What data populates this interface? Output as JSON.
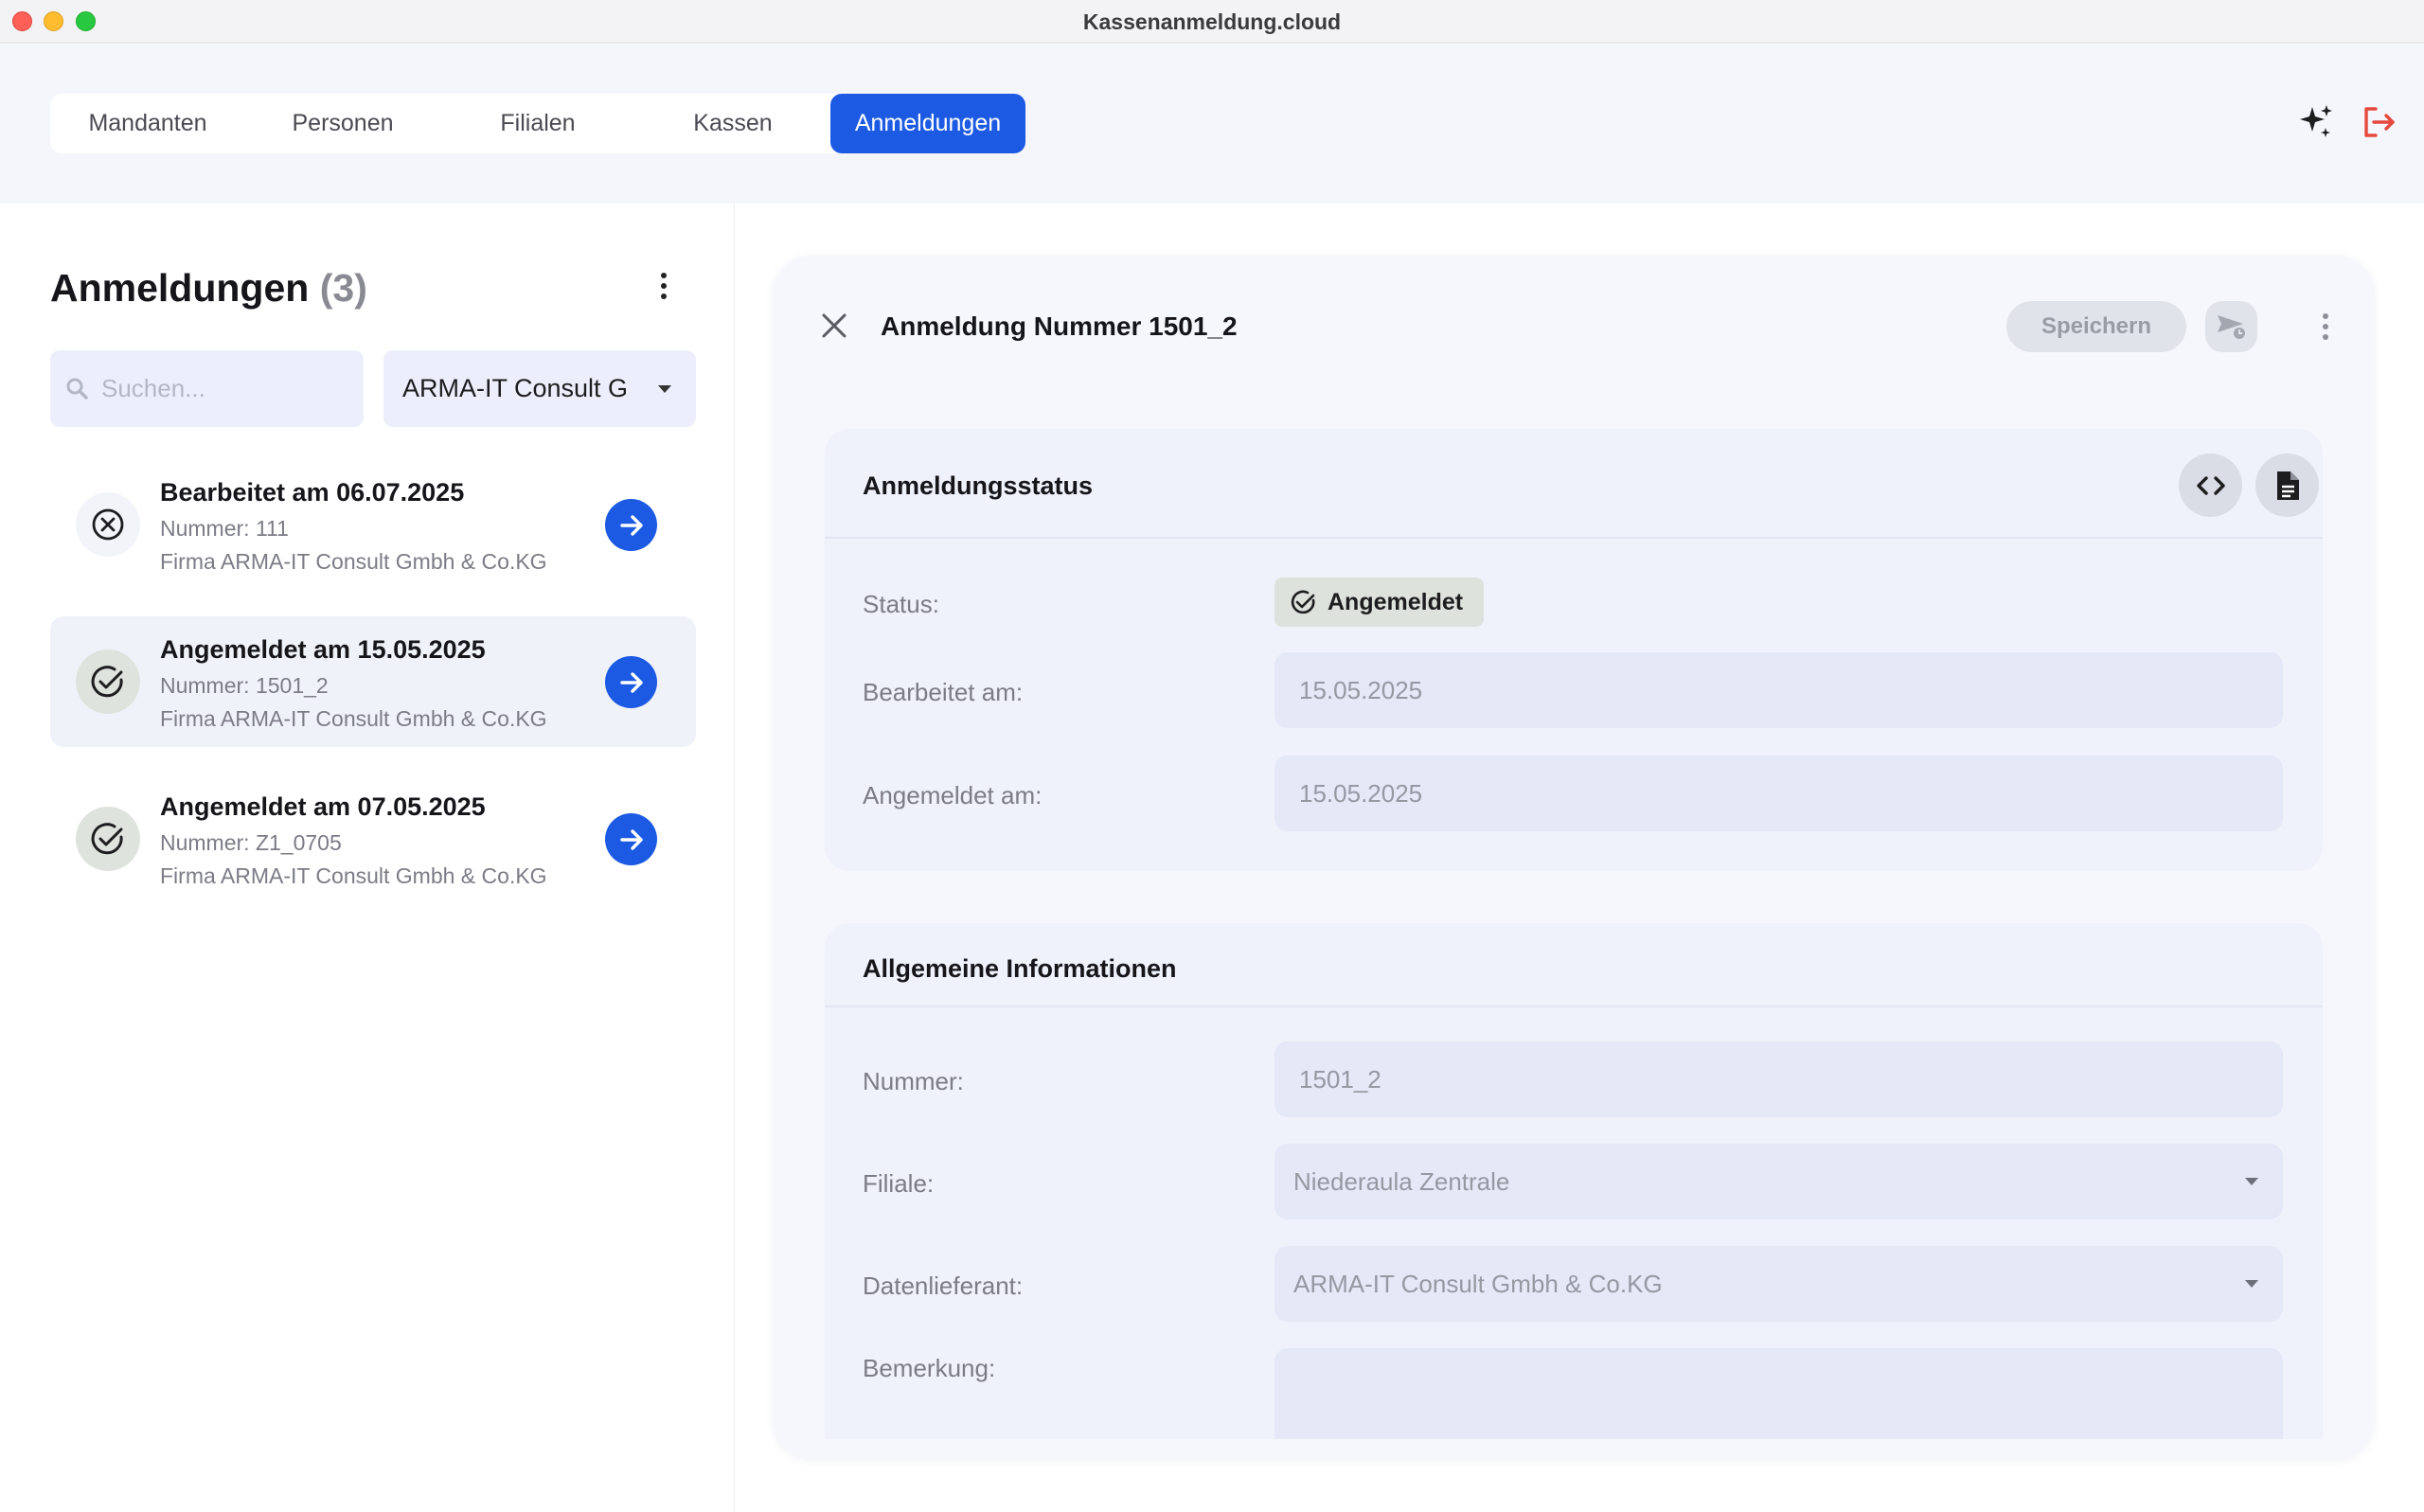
{
  "window": {
    "title": "Kassenanmeldung.cloud"
  },
  "nav": {
    "tabs": [
      {
        "label": "Mandanten",
        "active": false
      },
      {
        "label": "Personen",
        "active": false
      },
      {
        "label": "Filialen",
        "active": false
      },
      {
        "label": "Kassen",
        "active": false
      },
      {
        "label": "Anmeldungen",
        "active": true
      }
    ],
    "icons": {
      "sparkle": "sparkle-icon",
      "logout": "logout-icon"
    },
    "accent": "#1c5ae3",
    "logout_color": "#e5483d"
  },
  "list": {
    "title": "Anmeldungen",
    "count": "(3)",
    "search_placeholder": "Suchen...",
    "company_filter": "ARMA-IT Consult Gmbh & Co.KG",
    "items": [
      {
        "status": "rejected",
        "title": "Bearbeitet am 06.07.2025",
        "number": "Nummer: 111",
        "company": "Firma ARMA-IT Consult Gmbh & Co.KG",
        "selected": false
      },
      {
        "status": "ok",
        "title": "Angemeldet am 15.05.2025",
        "number": "Nummer: 1501_2",
        "company": "Firma ARMA-IT Consult Gmbh & Co.KG",
        "selected": true
      },
      {
        "status": "ok",
        "title": "Angemeldet am 07.05.2025",
        "number": "Nummer: Z1_0705",
        "company": "Firma ARMA-IT Consult Gmbh & Co.KG",
        "selected": false
      }
    ]
  },
  "detail": {
    "title": "Anmeldung Nummer 1501_2",
    "save_label": "Speichern",
    "status_section": {
      "title": "Anmeldungsstatus",
      "status_label": "Status:",
      "status_value": "Angemeldet",
      "edited_label": "Bearbeitet am:",
      "edited_value": "15.05.2025",
      "registered_label": "Angemeldet am:",
      "registered_value": "15.05.2025"
    },
    "general_section": {
      "title": "Allgemeine Informationen",
      "number_label": "Nummer:",
      "number_value": "1501_2",
      "branch_label": "Filiale:",
      "branch_value": "Niederaula Zentrale",
      "supplier_label": "Datenlieferant:",
      "supplier_value": "ARMA-IT Consult Gmbh & Co.KG",
      "remark_label": "Bemerkung:",
      "remark_value": ""
    }
  }
}
